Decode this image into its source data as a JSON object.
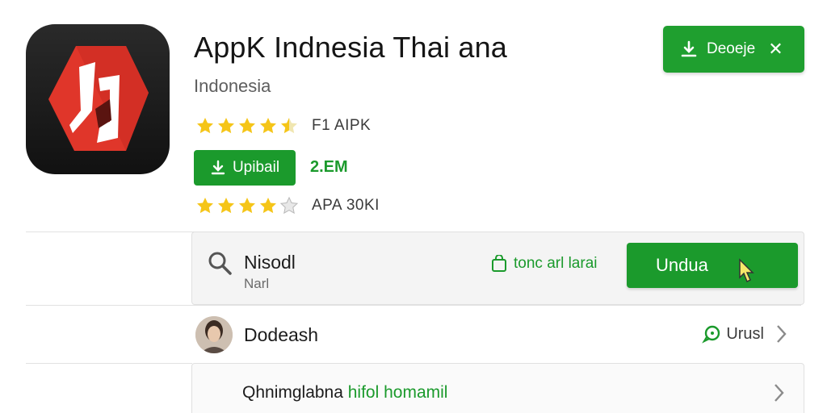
{
  "app": {
    "title": "AppK Indnesia Thai ana",
    "region": "Indonesia",
    "rating_line_1": "F1 AIPK",
    "rating_line_2": "APA 30KI",
    "rating_1": 4.5,
    "rating_2": 4.5,
    "update_label": "Upibail",
    "size_text": "2.EM",
    "icon_name": "app-logo-icon"
  },
  "header": {
    "download_label": "Deoeje"
  },
  "search_card": {
    "title": "Nisodl",
    "subtitle": "Narl",
    "tag_label": "tonc arl larai",
    "button_label": "Undua"
  },
  "person": {
    "name": "Dodeash",
    "status_label": "Urusl"
  },
  "bottom": {
    "text_prefix": "Qhnimglabna ",
    "text_highlight": "hifol homamil"
  },
  "colors": {
    "accent_green": "#1b9a2c",
    "star_yellow": "#f5c518",
    "icon_red": "#e0362a"
  }
}
